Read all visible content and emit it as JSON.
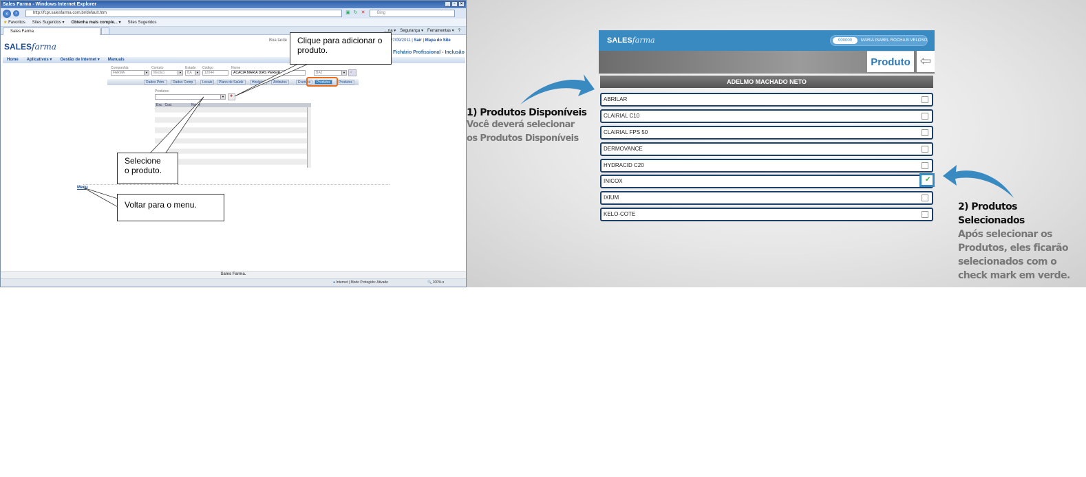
{
  "ie": {
    "title": "Sales Farma - Windows Internet Explorer",
    "url": "http://fcpr.salesfarma.com.br/default.htm",
    "search_placeholder": "Bing",
    "favorites_label": "Favoritos",
    "fav_items": [
      "Sites Sugeridos ▾",
      "Obtenha mais comple... ▾",
      "Sites Sugeridos"
    ],
    "tab_title": "Sales Farma",
    "cmd_items": [
      "…na ▾",
      "Segurança ▾",
      "Ferramentas ▾",
      "?"
    ],
    "status_zone": "Internet | Modo Protegido: Ativado",
    "zoom": "100%"
  },
  "site": {
    "logo_main": "SALES",
    "logo_script": "farma",
    "greeting": "Boa tarde",
    "date": "27/09/2011",
    "links": [
      "Sair",
      "Mapa do Site"
    ],
    "page_title": "Fichário Profissional - Inclusão",
    "menu": [
      "Home",
      "Aplicativos ▾",
      "Gestão de Internet ▾",
      "Manuais"
    ],
    "fields": {
      "companhia": {
        "label": "Companhia",
        "value": "FARMA"
      },
      "contato": {
        "label": "Contato",
        "value": "Medico"
      },
      "estado": {
        "label": "Estado",
        "value": "BA"
      },
      "codigo": {
        "label": "Código",
        "value": "12044"
      },
      "nome": {
        "label": "Nome",
        "value": "ACACIA MARIA DIAS PEREIR"
      },
      "extra": {
        "value": "BA2"
      }
    },
    "tabs": [
      "Dados Prim.",
      "Dados Comp.",
      "Locais",
      "Plano de Saúde",
      "Horários",
      "Atributos",
      "Eventos",
      "Produtos",
      "Produtos"
    ],
    "produtos_label": "Produtos",
    "grid_headers": [
      "Exc",
      "Cod.",
      "Nome"
    ],
    "menu_link": "Menu",
    "footer": "Sales Farma."
  },
  "callouts": {
    "add": "Clique para adicionar o produto.",
    "select": "Selecione o produto.",
    "menu": "Voltar para o menu."
  },
  "app": {
    "logo_main": "SALES",
    "logo_script": "farma",
    "user_code": "000000",
    "user_name": "MARIA ISABEL ROCHA B VELOSO",
    "screen_title": "Produto",
    "client": "ADELMO MACHADO NETO",
    "products": [
      {
        "name": "ABRILAR",
        "checked": false
      },
      {
        "name": "CLAIRIAL C10",
        "checked": false
      },
      {
        "name": "CLAIRIAL FPS 50",
        "checked": false
      },
      {
        "name": "DERMOVANCE",
        "checked": false
      },
      {
        "name": "HYDRACID C20",
        "checked": false
      },
      {
        "name": "INICOX",
        "checked": true
      },
      {
        "name": "IXIUM",
        "checked": false
      },
      {
        "name": "KELO-COTE",
        "checked": false
      }
    ]
  },
  "annotations": {
    "a1_title": "1) Produtos Disponíveis",
    "a1_line1": "Você deverá selecionar",
    "a1_line2": "os Produtos Disponíveis",
    "a2_title1": "2) Produtos",
    "a2_title2": "Selecionados",
    "a2_line1": "Após selecionar os",
    "a2_line2": "Produtos, eles ficarão",
    "a2_line3": "selecionados com o",
    "a2_line4": "check mark em verde."
  },
  "colors": {
    "accent": "#3a8ac2",
    "highlight": "#ee6a1b",
    "check": "#44aa44"
  }
}
